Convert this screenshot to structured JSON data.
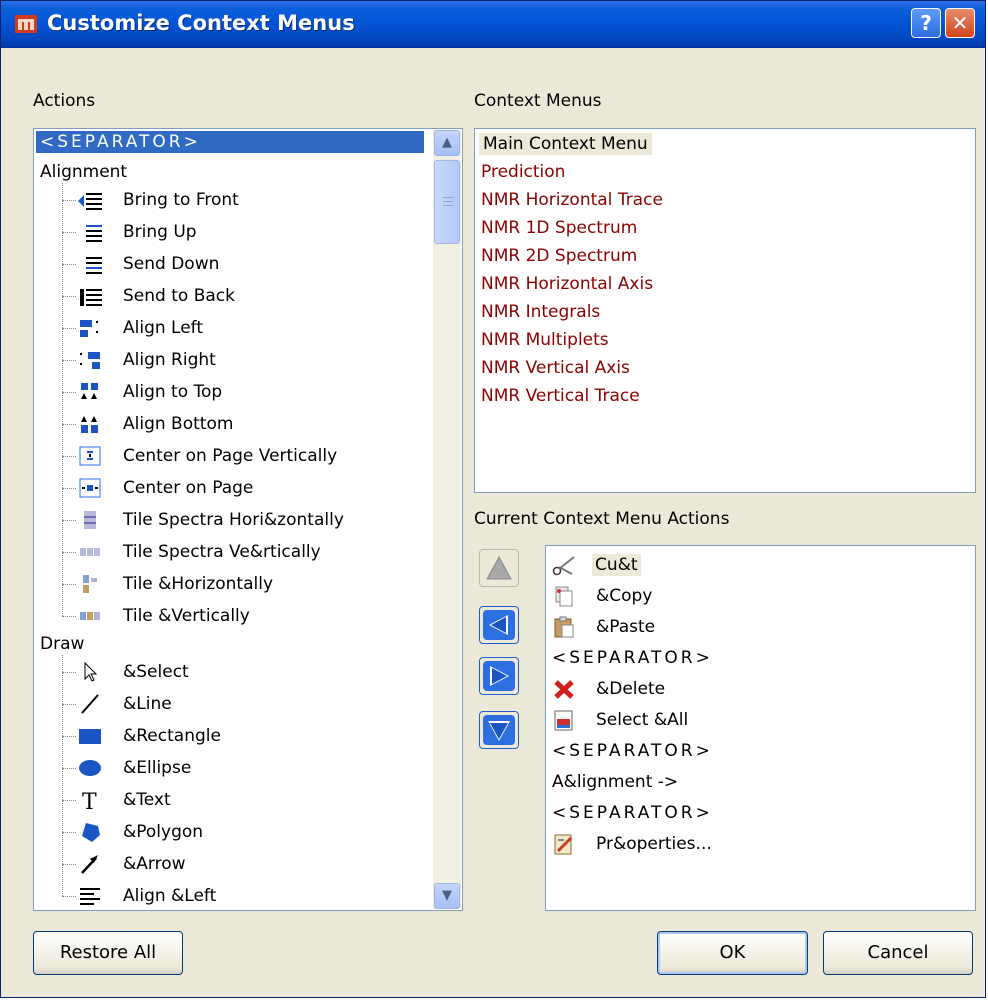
{
  "window": {
    "title": "Customize Context Menus",
    "help_label": "?",
    "close_label": "✕"
  },
  "actions": {
    "label": "Actions",
    "selected": "<SEPARATOR>",
    "groups": [
      {
        "name": "Alignment",
        "items": [
          {
            "label": "Bring to Front",
            "icon": "bring-to-front-icon"
          },
          {
            "label": "Bring Up",
            "icon": "bring-up-icon"
          },
          {
            "label": "Send Down",
            "icon": "send-down-icon"
          },
          {
            "label": "Send to Back",
            "icon": "send-to-back-icon"
          },
          {
            "label": "Align Left",
            "icon": "align-left-icon"
          },
          {
            "label": "Align Right",
            "icon": "align-right-icon"
          },
          {
            "label": "Align to Top",
            "icon": "align-top-icon"
          },
          {
            "label": "Align Bottom",
            "icon": "align-bottom-icon"
          },
          {
            "label": "Center on Page Vertically",
            "icon": "center-vertically-icon"
          },
          {
            "label": "Center on Page",
            "icon": "center-page-icon"
          },
          {
            "label": "Tile Spectra Hori&zontally",
            "icon": "tile-spectra-horizontal-icon"
          },
          {
            "label": "Tile Spectra Ve&rtically",
            "icon": "tile-spectra-vertical-icon"
          },
          {
            "label": "Tile &Horizontally",
            "icon": "tile-horizontal-icon"
          },
          {
            "label": "Tile &Vertically",
            "icon": "tile-vertical-icon"
          }
        ]
      },
      {
        "name": "Draw",
        "items": [
          {
            "label": "&Select",
            "icon": "cursor-arrow-icon"
          },
          {
            "label": "&Line",
            "icon": "line-icon"
          },
          {
            "label": "&Rectangle",
            "icon": "rectangle-icon"
          },
          {
            "label": "&Ellipse",
            "icon": "ellipse-icon"
          },
          {
            "label": "&Text",
            "icon": "text-icon"
          },
          {
            "label": "&Polygon",
            "icon": "polygon-icon"
          },
          {
            "label": "&Arrow",
            "icon": "arrow-icon"
          },
          {
            "label": "Align &Left",
            "icon": "align-text-left-icon"
          }
        ]
      }
    ]
  },
  "context_menus": {
    "label": "Context Menus",
    "items": [
      "Main Context Menu",
      "Prediction",
      "NMR Horizontal Trace",
      "NMR 1D Spectrum",
      "NMR 2D Spectrum",
      "NMR Horizontal Axis",
      "NMR Integrals",
      "NMR Multiplets",
      "NMR Vertical Axis",
      "NMR Vertical Trace"
    ],
    "selected_color": "#000000",
    "item_color": "#8b0000"
  },
  "current_actions": {
    "label": "Current Context Menu Actions",
    "items": [
      {
        "label": "Cu&t",
        "icon": "scissors-icon"
      },
      {
        "label": "&Copy",
        "icon": "copy-icon"
      },
      {
        "label": "&Paste",
        "icon": "paste-icon"
      },
      {
        "label": "<SEPARATOR>",
        "icon": ""
      },
      {
        "label": "&Delete",
        "icon": "delete-x-icon"
      },
      {
        "label": "Select &All",
        "icon": "select-all-icon"
      },
      {
        "label": "<SEPARATOR>",
        "icon": ""
      },
      {
        "label": "A&lignment ->",
        "icon": ""
      },
      {
        "label": "<SEPARATOR>",
        "icon": ""
      },
      {
        "label": "Pr&operties...",
        "icon": "properties-icon"
      }
    ]
  },
  "buttons": {
    "restore_all": "Restore All",
    "ok": "OK",
    "cancel": "Cancel"
  },
  "colors": {
    "title_bar": "#0354d6",
    "selection": "#316ac5",
    "dialog_bg": "#ece9d8",
    "arrow_blue": "#1c5fd3"
  }
}
